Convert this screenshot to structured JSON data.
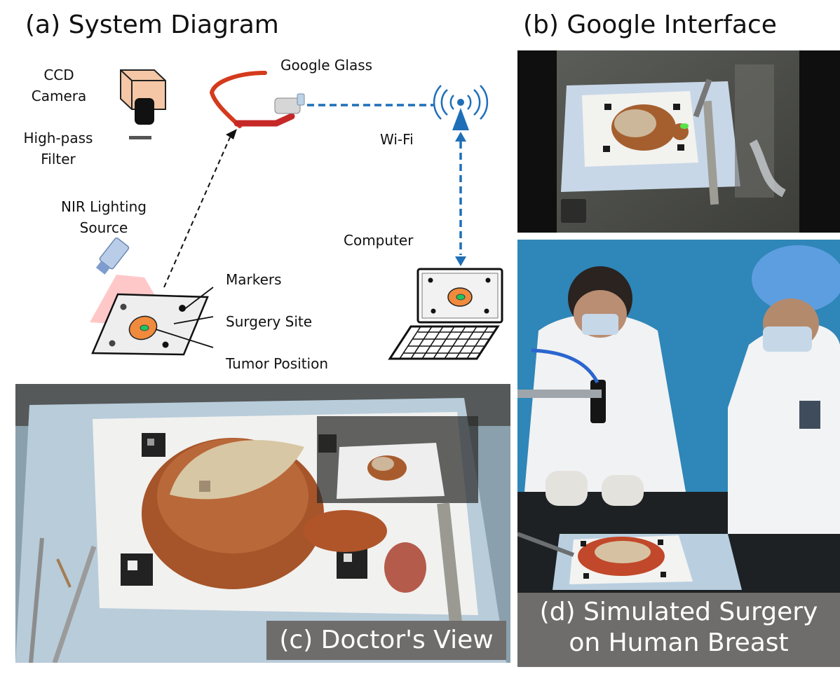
{
  "panels": {
    "a": {
      "title": "(a) System Diagram"
    },
    "b": {
      "title": "(b) Google Interface"
    },
    "c": {
      "caption": "(c) Doctor's View"
    },
    "d": {
      "caption_line1": "(d) Simulated Surgery",
      "caption_line2": "on Human Breast"
    }
  },
  "diagram": {
    "labels": {
      "ccd_line1": "CCD",
      "ccd_line2": "Camera",
      "filter_line1": "High-pass",
      "filter_line2": "Filter",
      "nir_line1": "NIR Lighting",
      "nir_line2": "Source",
      "google_glass": "Google Glass",
      "wifi": "Wi-Fi",
      "computer": "Computer",
      "markers": "Markers",
      "surgery_site": "Surgery Site",
      "tumor_position": "Tumor Position"
    },
    "colors": {
      "camera_body": "#f5c7a6",
      "tumor": "#f08a3c",
      "tumor_core": "#22c45a",
      "wifi_link": "#1f6fb8",
      "nir_beam": "#e53935",
      "glass_frame": "#d43a1c"
    }
  }
}
